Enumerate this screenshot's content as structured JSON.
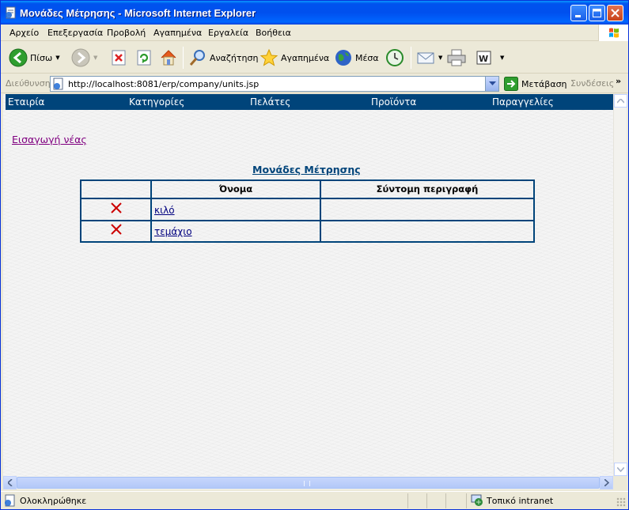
{
  "window": {
    "title": "Μονάδες Μέτρησης - Microsoft Internet Explorer"
  },
  "menu": [
    "Αρχείο",
    "Επεξεργασία",
    "Προβολή",
    "Αγαπημένα",
    "Εργαλεία",
    "Βοήθεια"
  ],
  "toolbar": {
    "back_label": "Πίσω",
    "search_label": "Αναζήτηση",
    "favorites_label": "Αγαπημένα",
    "media_label": "Μέσα"
  },
  "address": {
    "label": "Διεύθυνση",
    "url": "http://localhost:8081/erp/company/units.jsp",
    "go_label": "Μετάβαση",
    "links_label": "Συνδέσεις",
    "chevron": "»"
  },
  "nav": [
    "Εταιρία",
    "Κατηγορίες",
    "Πελάτες",
    "Προϊόντα",
    "Παραγγελίες"
  ],
  "page": {
    "insert_link": "Εισαγωγή νέας",
    "table_title": "Μονάδες Μέτρησης",
    "columns": [
      "",
      "Όνομα",
      "Σύντομη περιγραφή"
    ],
    "rows": [
      {
        "name": "κιλό",
        "description": ""
      },
      {
        "name": "τεμάχιο",
        "description": ""
      }
    ]
  },
  "status": {
    "text": "Ολοκληρώθηκε",
    "zone": "Τοπικό intranet"
  },
  "colors": {
    "nav_bg": "#00447a",
    "title_bar": "#0053ee",
    "visited_link": "#800080",
    "delete_icon": "#cc0000"
  }
}
